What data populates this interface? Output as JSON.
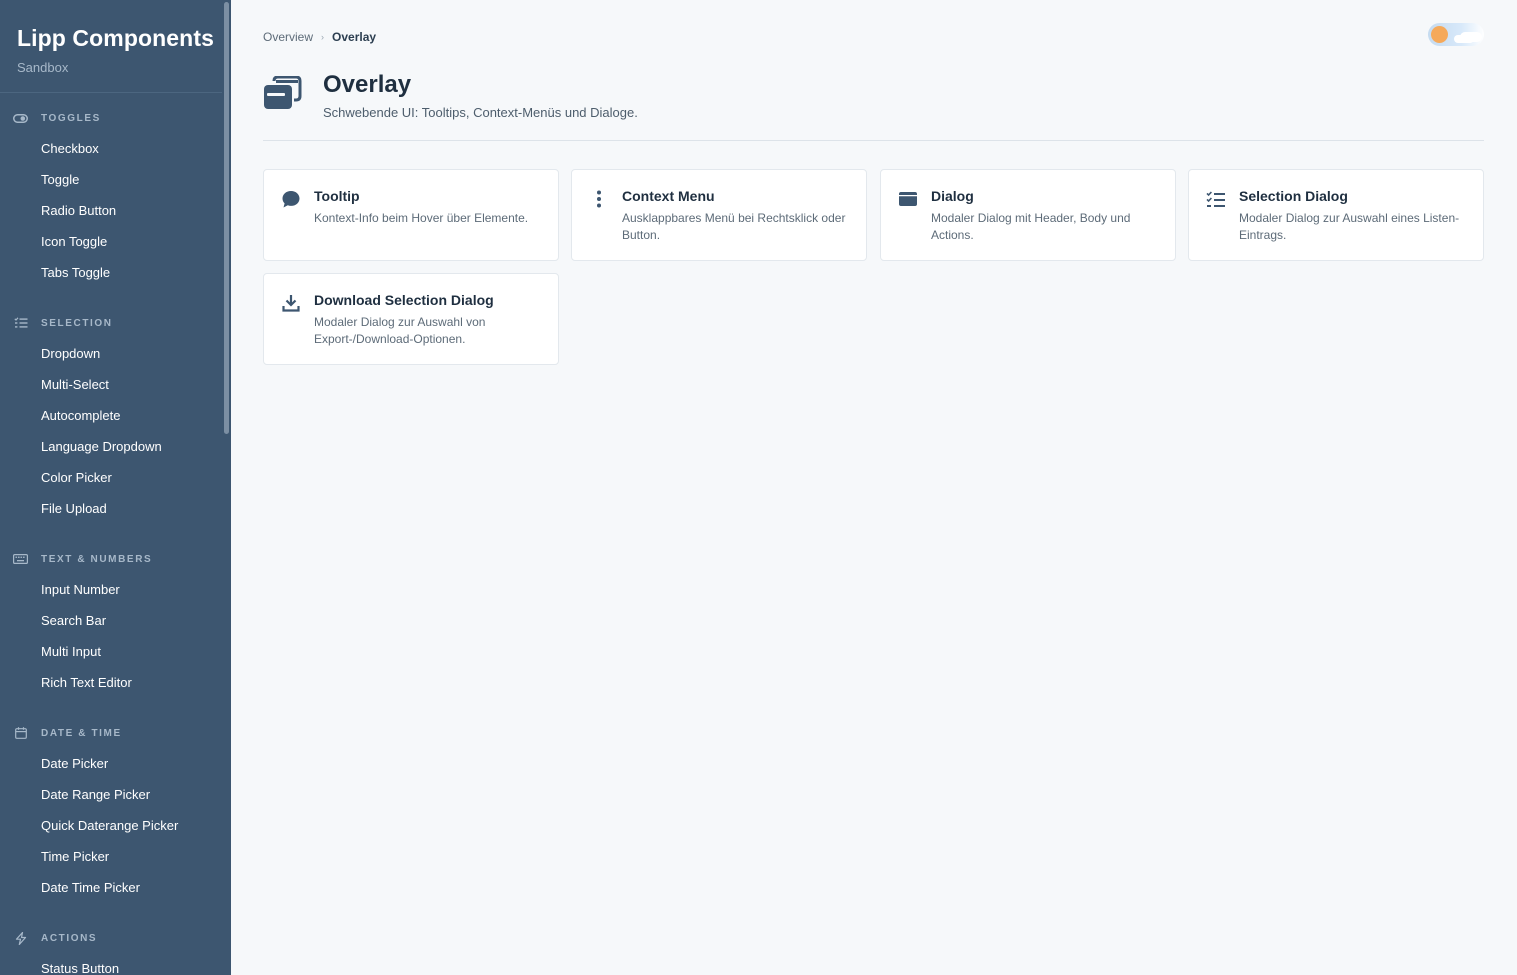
{
  "brand": {
    "title": "Lipp Components",
    "subtitle": "Sandbox"
  },
  "sidebar": {
    "sections": [
      {
        "label": "TOGGLES",
        "icon": "toggle-icon",
        "items": [
          "Checkbox",
          "Toggle",
          "Radio Button",
          "Icon Toggle",
          "Tabs Toggle"
        ]
      },
      {
        "label": "SELECTION",
        "icon": "list-check-icon",
        "items": [
          "Dropdown",
          "Multi-Select",
          "Autocomplete",
          "Language Dropdown",
          "Color Picker",
          "File Upload"
        ]
      },
      {
        "label": "TEXT & NUMBERS",
        "icon": "keyboard-icon",
        "items": [
          "Input Number",
          "Search Bar",
          "Multi Input",
          "Rich Text Editor"
        ]
      },
      {
        "label": "DATE & TIME",
        "icon": "calendar-icon",
        "items": [
          "Date Picker",
          "Date Range Picker",
          "Quick Daterange Picker",
          "Time Picker",
          "Date Time Picker"
        ]
      },
      {
        "label": "ACTIONS",
        "icon": "bolt-icon",
        "items": [
          "Status Button"
        ]
      }
    ]
  },
  "breadcrumb": {
    "home": "Overview",
    "separator": "›",
    "current": "Overlay"
  },
  "theme_toggle": {
    "icon": "sun-icon"
  },
  "header": {
    "icon": "window-stack-icon",
    "title": "Overlay",
    "description": "Schwebende UI: Tooltips, Context-Menüs und Dialoge."
  },
  "cards": [
    {
      "icon": "speech-bubble-icon",
      "title": "Tooltip",
      "description": "Kontext-Info beim Hover über Elemente."
    },
    {
      "icon": "vertical-dots-icon",
      "title": "Context Menu",
      "description": "Ausklappbares Menü bei Rechtsklick oder Button."
    },
    {
      "icon": "window-icon",
      "title": "Dialog",
      "description": "Modaler Dialog mit Header, Body und Actions."
    },
    {
      "icon": "list-check-icon",
      "title": "Selection Dialog",
      "description": "Modaler Dialog zur Auswahl eines Listen-Eintrags."
    },
    {
      "icon": "download-icon",
      "title": "Download Selection Dialog",
      "description": "Modaler Dialog zur Auswahl von Export-/Download-Optionen."
    }
  ],
  "colors": {
    "sidebar_bg": "#3d5670",
    "page_bg": "#f6f8fa",
    "card_bg": "#ffffff",
    "text_dark": "#1f2f40"
  }
}
